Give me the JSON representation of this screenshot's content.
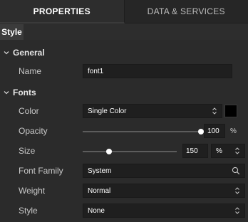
{
  "tabs": [
    {
      "label": "PROPERTIES",
      "active": true
    },
    {
      "label": "DATA & SERVICES",
      "active": false
    }
  ],
  "subtab": {
    "label": "Style"
  },
  "sections": {
    "general": {
      "title": "General",
      "name_label": "Name",
      "name_value": "font1"
    },
    "fonts": {
      "title": "Fonts",
      "color_label": "Color",
      "color_mode": "Single Color",
      "color_swatch": "#000000",
      "opacity_label": "Opacity",
      "opacity_value": "100",
      "opacity_unit": "%",
      "opacity_fraction": 1.0,
      "size_label": "Size",
      "size_value": "150",
      "size_unit": "%",
      "size_fraction": 0.28,
      "font_family_label": "Font Family",
      "font_family_value": "System",
      "weight_label": "Weight",
      "weight_value": "Normal",
      "style_label": "Style",
      "style_value": "None"
    }
  },
  "icons": {
    "expand": "chevron-down-icon",
    "select": "updown-chevron-icon",
    "search": "search-icon"
  }
}
